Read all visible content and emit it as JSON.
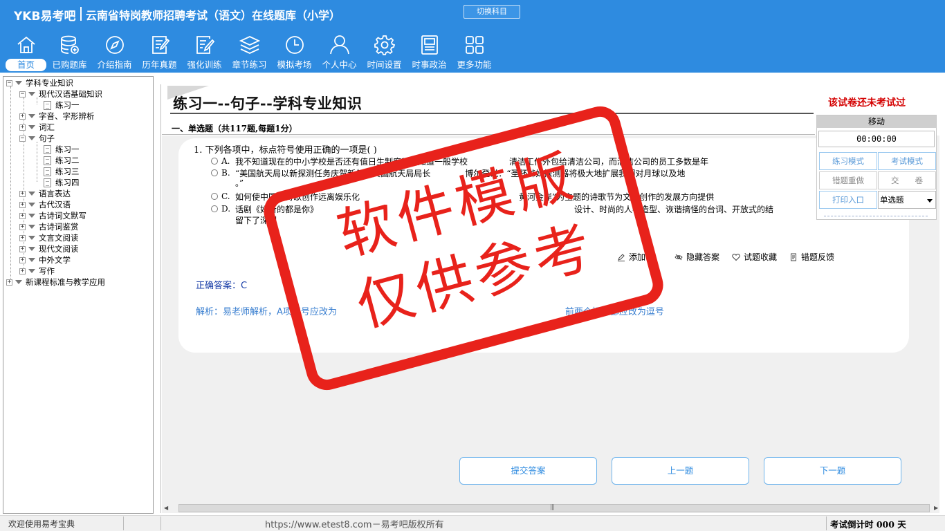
{
  "app": {
    "logo": "YKB易考吧",
    "title": "云南省特岗教师招聘考试（语文）在线题库（小学）",
    "switch_label": "切换科目"
  },
  "nav": [
    {
      "label": "首页",
      "icon": "home-icon",
      "active": true
    },
    {
      "label": "已购题库",
      "icon": "database-icon"
    },
    {
      "label": "介绍指南",
      "icon": "compass-icon"
    },
    {
      "label": "历年真题",
      "icon": "checklist-icon"
    },
    {
      "label": "强化训练",
      "icon": "edit-doc-icon"
    },
    {
      "label": "章节练习",
      "icon": "layers-icon"
    },
    {
      "label": "模拟考场",
      "icon": "clock-icon"
    },
    {
      "label": "个人中心",
      "icon": "user-icon"
    },
    {
      "label": "时间设置",
      "icon": "gear-icon"
    },
    {
      "label": "时事政治",
      "icon": "news-icon"
    },
    {
      "label": "更多功能",
      "icon": "grid-icon"
    }
  ],
  "tree": [
    {
      "label": "学科专业知识"
    },
    {
      "label": "现代汉语基础知识"
    },
    {
      "label": "练习一"
    },
    {
      "label": "字音、字形辨析"
    },
    {
      "label": "词汇"
    },
    {
      "label": "句子"
    },
    {
      "label": "练习一"
    },
    {
      "label": "练习二"
    },
    {
      "label": "练习三"
    },
    {
      "label": "练习四"
    },
    {
      "label": "语言表达"
    },
    {
      "label": "古代汉语"
    },
    {
      "label": "古诗词文默写"
    },
    {
      "label": "古诗词鉴赏"
    },
    {
      "label": "文言文阅读"
    },
    {
      "label": "现代文阅读"
    },
    {
      "label": "中外文学"
    },
    {
      "label": "写作"
    },
    {
      "label": "新课程标准与教学应用"
    }
  ],
  "paper": {
    "title": "练习一--句子--学科专业知识",
    "section": "一、单选题（共117题,每题1分）",
    "status_notice": "该试卷还未考试过"
  },
  "question": {
    "text": "1. 下列各项中，标点符号使用正确的一项是(  )",
    "options": [
      {
        "key": "A.",
        "text": "我不知道现在的中小学校是否还有值日生制度？只知道一般学校",
        "tail": "清洁工作外包给清洁公司，而清洁公司的员工多数是年"
      },
      {
        "key": "B.",
        "text": "“美国航天局以新探测任务庆贺新年，”美国航天局局长",
        "tail": "博尔登说：“圣杯姊妹探测器将极大地扩展我们对月球以及地",
        "line2": "。”"
      },
      {
        "key": "C.",
        "text": "如何使中国的诗歌创作远离娱乐化",
        "tail": "黄河金岸”为主题的诗歌节为文学创作的发展方向提供"
      },
      {
        "key": "D.",
        "text": "话剧《好听的都是你》",
        "tail": "设计、时尚的人物造型、诙谐搞怪的台词、开放式的结",
        "line2": "留下了深刻"
      }
    ],
    "actions": [
      "添加",
      "隐藏答案",
      "试题收藏",
      "错题反馈"
    ],
    "answer": "正确答案：C",
    "analysis": "解析：易老师解析，A项问号应改为",
    "analysis_tail": "前两个括号都应改为逗号"
  },
  "float_panel": {
    "header": "移动",
    "timer": "00:00:00",
    "buttons": [
      "练习模式",
      "考试模式",
      "错题重做",
      "交　　卷",
      "打印入口"
    ],
    "select_value": "单选题"
  },
  "bottom_buttons": [
    "提交答案",
    "上一题",
    "下一题"
  ],
  "statusbar": {
    "welcome": "欢迎使用易考宝典",
    "copyright": "https://www.etest8.com－易考吧版权所有",
    "countdown": "考试倒计时 000 天"
  },
  "watermark": {
    "line1": "软件模版",
    "line2": "仅供参考"
  },
  "colors": {
    "brand": "#2e8be0",
    "stamp": "#e8221b",
    "notice": "#d40000"
  }
}
